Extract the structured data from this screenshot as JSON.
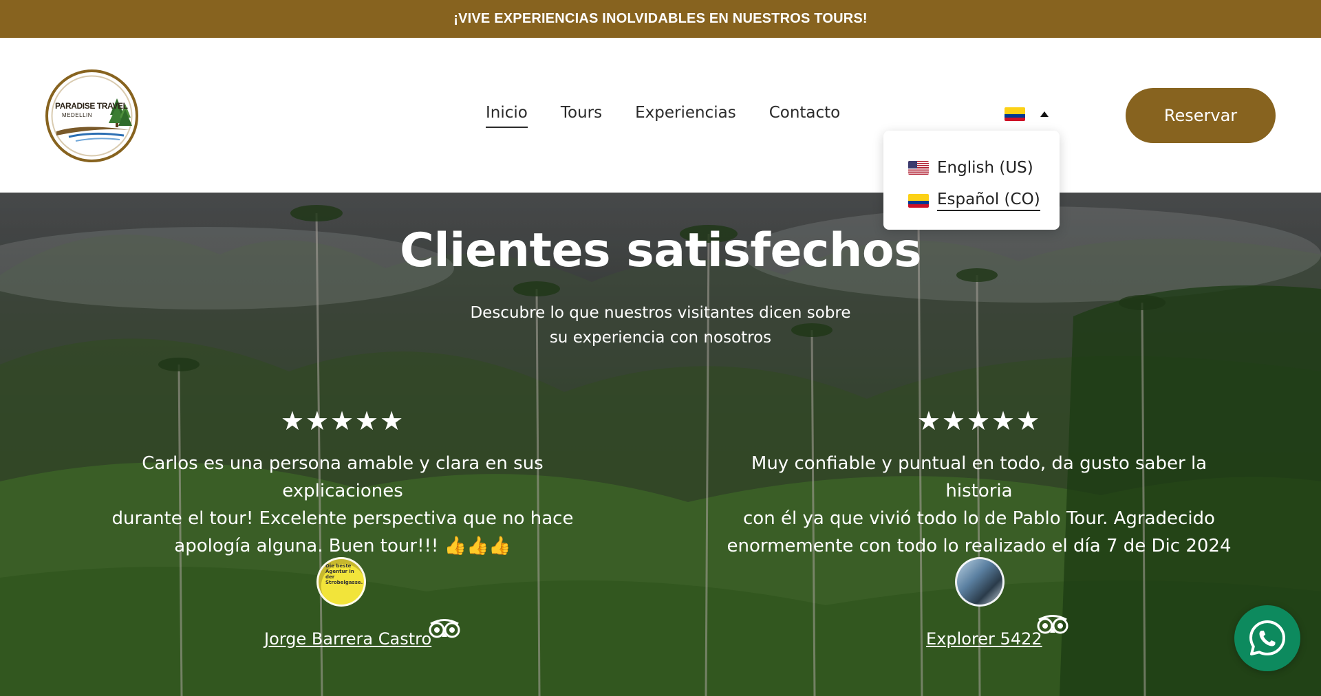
{
  "announcement": "¡VIVE EXPERIENCIAS INOLVIDABLES EN NUESTROS TOURS!",
  "logo": {
    "title": "PARADISE TRAVEL",
    "subtitle": "MEDELLIN"
  },
  "nav": {
    "items": [
      {
        "label": "Inicio",
        "active": true
      },
      {
        "label": "Tours",
        "active": false
      },
      {
        "label": "Experiencias",
        "active": false
      },
      {
        "label": "Contacto",
        "active": false
      }
    ]
  },
  "language": {
    "current_flag": "flag-co-icon",
    "options": [
      {
        "label": "English (US)",
        "flag": "flag-us-icon",
        "selected": false
      },
      {
        "label": "Español (CO)",
        "flag": "flag-co-icon",
        "selected": true
      }
    ]
  },
  "reserve_label": "Reservar",
  "testimonials": {
    "title": "Clientes satisfechos",
    "subtitle_line1": "Descubre lo que nuestros visitantes dicen sobre",
    "subtitle_line2": "su experiencia con nosotros",
    "reviews": [
      {
        "stars": "★★★★★",
        "rating": 5,
        "line1": "Carlos es una persona amable y clara en sus explicaciones",
        "line2": "durante el tour! Excelente perspectiva que no hace",
        "line3": "apología alguna. Buen tour!!! 👍👍👍",
        "author": "Jorge Barrera Castro",
        "avatar_text": "Die beste Agentur in der Strobelgasse."
      },
      {
        "stars": "★★★★★",
        "rating": 5,
        "line1": "Muy confiable y puntual en todo, da gusto saber la historia",
        "line2": "con él ya que vivió todo lo de Pablo Tour. Agradecido",
        "line3": "enormemente con todo lo realizado el día 7 de Dic 2024",
        "author": "Explorer 5422"
      }
    ]
  },
  "colors": {
    "brand": "#87631f",
    "whatsapp": "#0d8a5e"
  }
}
